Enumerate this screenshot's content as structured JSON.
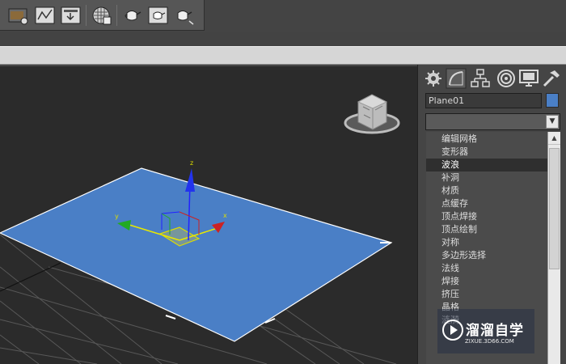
{
  "toolbar": {
    "buttons": [
      "scene-explorer",
      "curve-editor",
      "render-setup",
      "material-editor",
      "teapot-render",
      "teapot-frame",
      "teapot-production"
    ]
  },
  "viewport": {
    "object_color": "#4a7fc6",
    "gizmo": {
      "x_label": "x",
      "y_label": "y",
      "z_label": "z"
    }
  },
  "command_panel": {
    "tabs": [
      "create-icon",
      "modify-icon",
      "hierarchy-icon",
      "motion-icon",
      "display-icon",
      "utilities-icon"
    ],
    "object_name": "Plane01",
    "object_color": "#4a7fc6",
    "modifier_list_value": "",
    "modifiers": [
      "编辑网格",
      "变形器",
      "波浪",
      "补洞",
      "材质",
      "点缓存",
      "顶点焊接",
      "顶点绘制",
      "对称",
      "多边形选择",
      "法线",
      "焊接",
      "挤压",
      "晶格",
      "涟漪"
    ],
    "selected_modifier": "波浪"
  },
  "watermark": {
    "title": "溜溜自学",
    "url": "ZIXUE.3D66.COM"
  }
}
